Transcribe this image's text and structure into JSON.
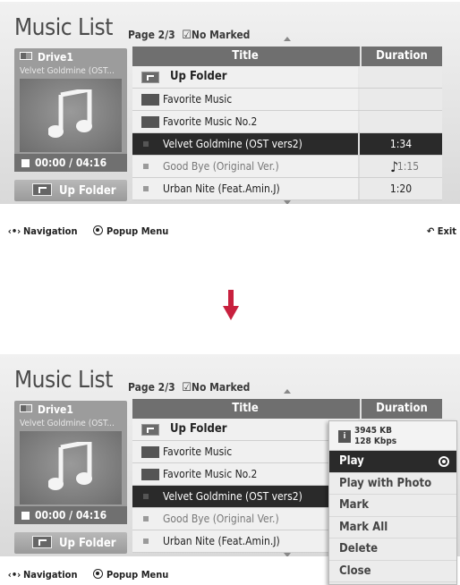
{
  "before": {
    "title": "Music List",
    "page": "Page 2/3",
    "marked": "No Marked",
    "drive": "Drive1",
    "album": "Velvet Goldmine (OST...",
    "time": "00:00 / 04:16",
    "up_folder_button": "Up Folder",
    "columns": {
      "title": "Title",
      "duration": "Duration"
    },
    "rows": [
      {
        "name": "Up Folder",
        "duration": ""
      },
      {
        "name": "Favorite Music",
        "duration": ""
      },
      {
        "name": "Favorite Music No.2",
        "duration": ""
      },
      {
        "name": "Velvet Goldmine (OST vers2)",
        "duration": "1:34"
      },
      {
        "name": "Good Bye (Original Ver.)",
        "duration": "1:15"
      },
      {
        "name": "Urban Nite (Feat.Amin.J)",
        "duration": "1:20"
      }
    ]
  },
  "after": {
    "title": "Music List",
    "page": "Page 2/3",
    "marked": "No Marked",
    "drive": "Drive1",
    "album": "Velvet Goldmine (OST...",
    "time": "00:00 / 04:16",
    "up_folder_button": "Up Folder",
    "columns": {
      "title": "Title",
      "duration": "Duration"
    },
    "rows": [
      {
        "name": "Up Folder"
      },
      {
        "name": "Favorite Music"
      },
      {
        "name": "Favorite Music No.2"
      },
      {
        "name": "Velvet Goldmine (OST vers2)"
      },
      {
        "name": "Good Bye (Original Ver.)"
      },
      {
        "name": "Urban Nite (Feat.Amin.J)"
      }
    ],
    "popup": {
      "size": "3945 KB",
      "bitrate": "128 Kbps",
      "items": [
        "Play",
        "Play with Photo",
        "Mark",
        "Mark All",
        "Delete",
        "Close"
      ]
    }
  },
  "footer": {
    "navigation": "Navigation",
    "popup_menu": "Popup Menu",
    "exit": "Exit"
  },
  "colors": {
    "transition_arrow": "#c8203e",
    "selected_row": "#2a2a2a"
  },
  "icons": {
    "marked": "checkbox-icon",
    "playing": "music-note-icon",
    "exit": "return-icon"
  }
}
